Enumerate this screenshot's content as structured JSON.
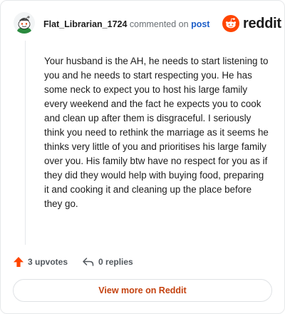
{
  "comment": {
    "username": "Flat_Librarian_1724",
    "action_text": "commented on",
    "post_link": "post",
    "body": "Your husband is the AH, he needs to start listening to you and he needs to start respecting you. He has some neck to expect you to host his large family every weekend and the fact he expects you to cook and clean up after them is disgraceful. I seriously think you need to rethink the marriage as it seems he thinks very little of you and prioritises his large family over you. His family btw have no respect for you as if they did they would help with buying food, preparing it and cooking it and cleaning up the place before they go.",
    "upvotes_label": "3 upvotes",
    "replies_label": "0 replies"
  },
  "brand": {
    "logo_text": "reddit",
    "color": "#ff4500"
  },
  "footer": {
    "view_more_label": "View more on Reddit"
  },
  "icons": {
    "upvote": "upvote-arrow-icon",
    "reply": "reply-arrow-icon",
    "logo": "reddit-snoo-icon",
    "avatar": "user-avatar"
  }
}
